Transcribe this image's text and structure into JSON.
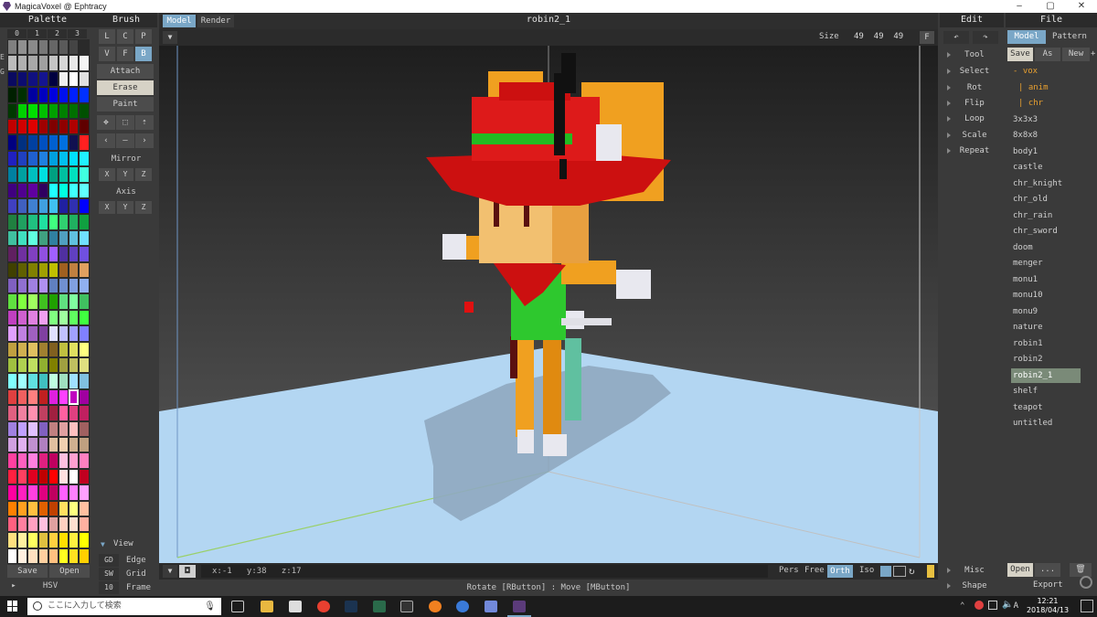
{
  "window": {
    "title": "MagicaVoxel @ Ephtracy"
  },
  "palette": {
    "header": "Palette",
    "pages": [
      "0",
      "1",
      "2",
      "3"
    ],
    "side_letters": [
      "E",
      "G"
    ],
    "save_label": "Save",
    "open_label": "Open",
    "hsv_label": "HSV"
  },
  "brush": {
    "header": "Brush",
    "row1": [
      "L",
      "C",
      "P"
    ],
    "row2": [
      "V",
      "F",
      "B"
    ],
    "modes": [
      "Attach",
      "Erase",
      "Paint"
    ],
    "mirror_label": "Mirror",
    "axis_label": "Axis",
    "axes": [
      "X",
      "Y",
      "Z"
    ],
    "nav": [
      "‹",
      "—",
      "›"
    ]
  },
  "view": {
    "header": "View",
    "rows": [
      {
        "key": "GD",
        "label": "Edge"
      },
      {
        "key": "SW",
        "label": "Grid"
      },
      {
        "key": "10",
        "label": "Frame"
      }
    ]
  },
  "viewport": {
    "tabs": [
      "Model",
      "Render"
    ],
    "active_tab": "Model",
    "model_name": "robin2_1",
    "size_label": "Size",
    "size_values": "49  49  49",
    "f_label": "F",
    "coords": "x:-1   y:38   z:17",
    "projections": [
      "Pers",
      "Free",
      "Orth",
      "Iso"
    ],
    "active_projection": "Orth",
    "hint": "Rotate [RButton] : Move [MButton]"
  },
  "edit": {
    "header": "Edit",
    "items": [
      "Tool",
      "Select",
      "Rot",
      "Flip",
      "Loop",
      "Scale",
      "Repeat"
    ],
    "bottom_items": [
      "Misc",
      "Shape"
    ]
  },
  "file": {
    "header": "File",
    "tabs": [
      "Model",
      "Pattern"
    ],
    "buttons": [
      "Save",
      "As",
      "New",
      "+"
    ],
    "tree": [
      "- vox",
      "| anim",
      "| chr"
    ],
    "files": [
      "3x3x3",
      "8x8x8",
      "body1",
      "castle",
      "chr_knight",
      "chr_old",
      "chr_rain",
      "chr_sword",
      "doom",
      "menger",
      "monu1",
      "monu10",
      "monu9",
      "nature",
      "robin1",
      "robin2",
      "robin2_1",
      "shelf",
      "teapot",
      "untitled"
    ],
    "selected_file": "robin2_1",
    "open_label": "Open",
    "dots_label": "...",
    "export_label": "Export"
  },
  "taskbar": {
    "search_placeholder": "ここに入力して検索",
    "time": "12:21",
    "date": "2018/04/13",
    "ime": "A"
  },
  "colors": {
    "viewport_floor": "#b3d6f2",
    "accent": "#7aa7c7",
    "selected_swatch_border": "#ffffff"
  }
}
